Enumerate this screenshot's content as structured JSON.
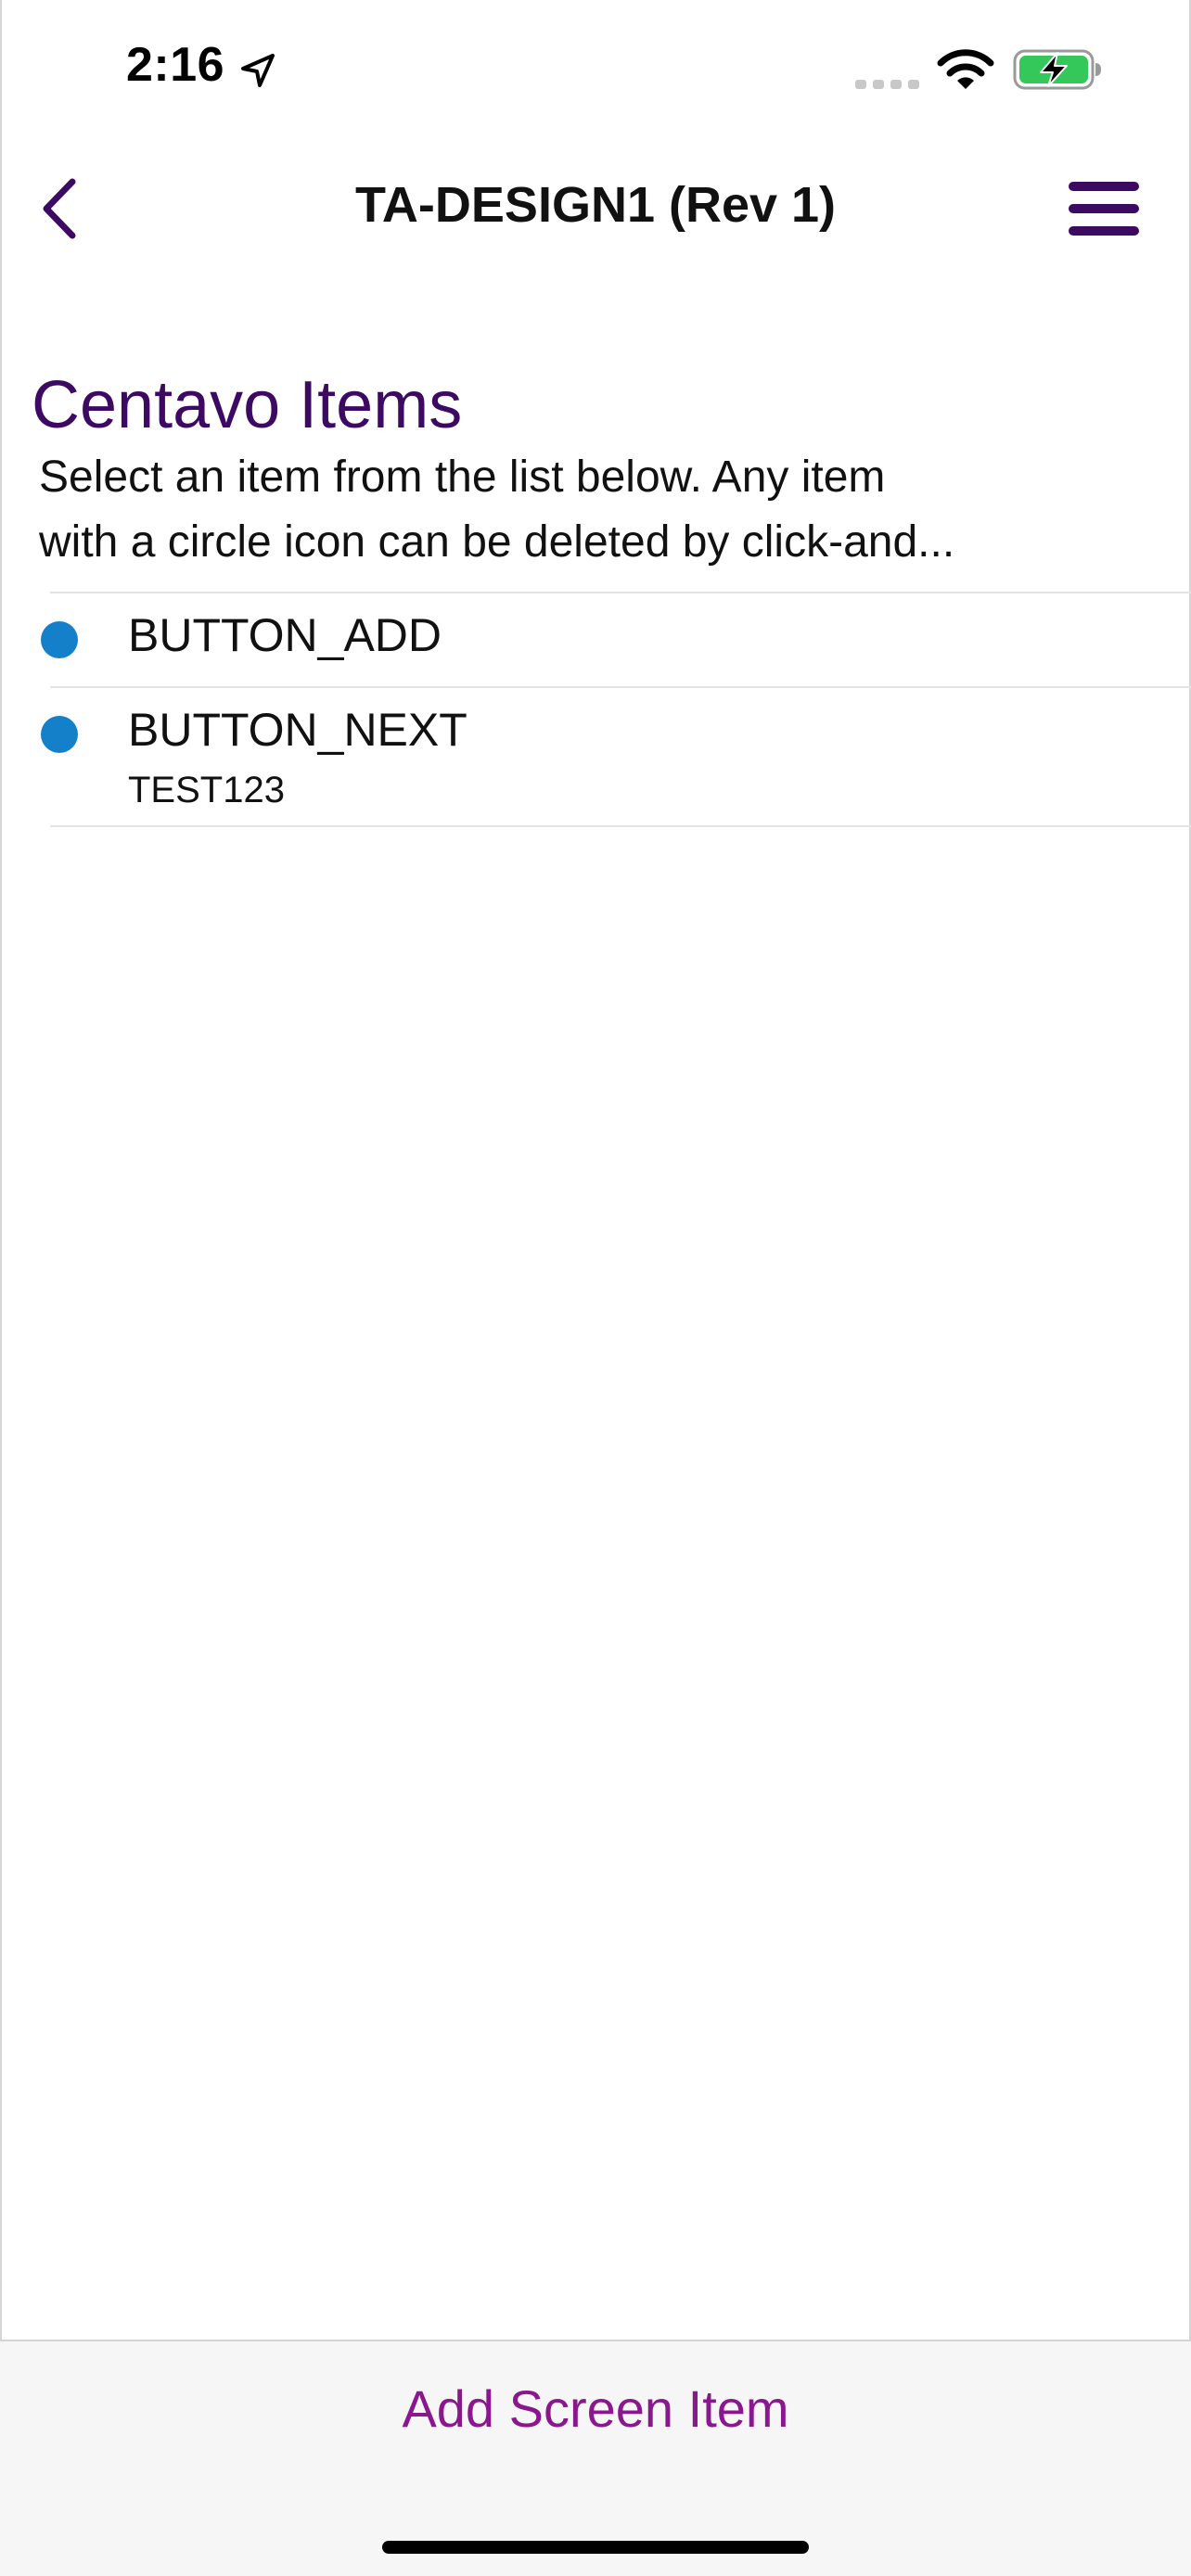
{
  "status_bar": {
    "time": "2:16",
    "icons": [
      "location-arrow-icon",
      "cellular-signal-icon",
      "wifi-icon",
      "battery-charging-icon"
    ],
    "battery_color": "#34c759"
  },
  "nav": {
    "title": "TA-DESIGN1 (Rev 1)",
    "back_icon": "chevron-left-icon",
    "menu_icon": "hamburger-menu-icon",
    "accent_color": "#3d0a63"
  },
  "header": {
    "title": "Centavo Items",
    "description_line1": "Select an item from the list below. Any item",
    "description_line2": "with a circle icon can be deleted by click-and..."
  },
  "items": [
    {
      "title": "BUTTON_ADD",
      "subtitle": ""
    },
    {
      "title": "BUTTON_NEXT",
      "subtitle": "TEST123"
    }
  ],
  "item_dot_color": "#1380c9",
  "toolbar": {
    "add_label": "Add Screen Item",
    "add_color": "#8a178e"
  }
}
